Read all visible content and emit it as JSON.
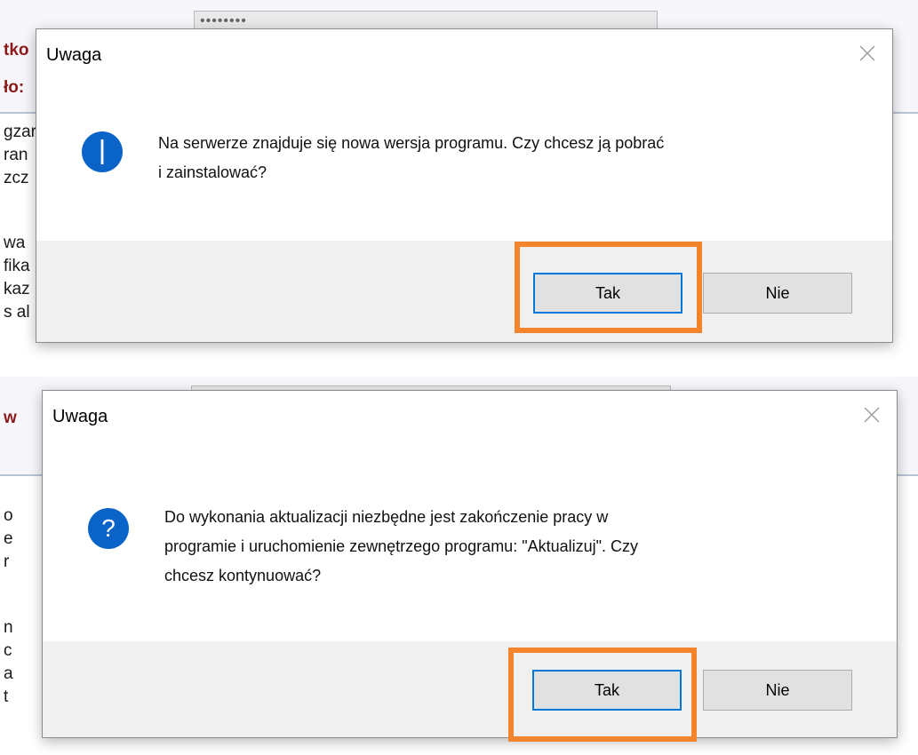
{
  "dialog1": {
    "title": "Uwaga",
    "icon": "info-icon",
    "message_line1": "Na serwerze znajduje się nowa wersja programu. Czy chcesz ją pobrać",
    "message_line2": "i zainstalować?",
    "yes_label": "Tak",
    "no_label": "Nie",
    "background": {
      "field_text": "••••••••",
      "heading1": "tko",
      "heading2": "ło:",
      "lines": [
        "gzar",
        "ran",
        "zcz",
        "",
        "wa",
        "fika",
        "kaz",
        "s al"
      ]
    }
  },
  "dialog2": {
    "title": "Uwaga",
    "icon": "question-icon",
    "message_line1": "Do wykonania aktualizacji niezbędne jest zakończenie pracy w",
    "message_line2": "programie i uruchomienie zewnętrzego programu: \"Aktualizuj\". Czy",
    "message_line3": "chcesz kontynuować?",
    "yes_label": "Tak",
    "no_label": "Nie",
    "background": {
      "heading1": "w",
      "lines": [
        "o",
        "e",
        "r",
        "",
        "n",
        "c",
        "a",
        "t"
      ]
    }
  },
  "colors": {
    "highlight": "#f4852c",
    "default_button_border": "#0078d7",
    "icon_blue": "#0a64c8",
    "footer": "#f0f0f0"
  }
}
